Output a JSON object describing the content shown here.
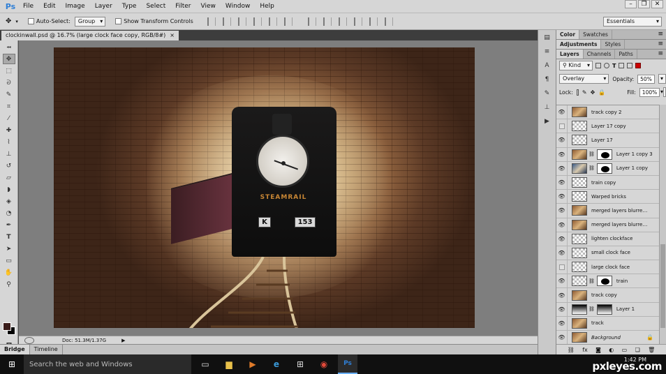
{
  "app": {
    "logo": "Ps"
  },
  "menu": [
    "File",
    "Edit",
    "Image",
    "Layer",
    "Type",
    "Select",
    "Filter",
    "View",
    "Window",
    "Help"
  ],
  "window_controls": [
    "–",
    "❐",
    "✕"
  ],
  "options": {
    "auto_select_label": "Auto-Select:",
    "auto_select_value": "Group",
    "transform_label": "Show Transform Controls",
    "workspace": "Essentials"
  },
  "document": {
    "tab_title": "clockinwall.psd @ 16.7% (large clock face copy, RGB/8#)",
    "close": "×",
    "nameplate": "STEAMRAIL",
    "plate_k": "K",
    "plate_number": "153"
  },
  "status": {
    "doc_info": "Doc: 51.3M/1.37G",
    "arrow": "▶"
  },
  "bottom_tabs": [
    "Bridge",
    "Timeline"
  ],
  "panels": {
    "tabs_row1": [
      "Color",
      "Swatches"
    ],
    "tabs_row2": [
      "Adjustments",
      "Styles"
    ],
    "tabs_row3": [
      "Layers",
      "Channels",
      "Paths"
    ]
  },
  "layers_panel": {
    "kind": "Kind",
    "blend_mode": "Overlay",
    "opacity_label": "Opacity:",
    "opacity_value": "50%",
    "lock_label": "Lock:",
    "fill_label": "Fill:",
    "fill_value": "100%",
    "layers": [
      {
        "name": "track copy 2",
        "visible": true
      },
      {
        "name": "Layer 17 copy",
        "visible": false
      },
      {
        "name": "Layer 17",
        "visible": true
      },
      {
        "name": "Layer 1 copy 3",
        "visible": true
      },
      {
        "name": "Layer 1 copy",
        "visible": true
      },
      {
        "name": "train copy",
        "visible": true
      },
      {
        "name": "Warped bricks",
        "visible": true
      },
      {
        "name": "merged layers blurred c...",
        "visible": true
      },
      {
        "name": "merged layers blurred c...",
        "visible": true
      },
      {
        "name": "lighten clockface",
        "visible": true
      },
      {
        "name": "small clock face",
        "visible": true
      },
      {
        "name": "large clock face",
        "visible": false
      },
      {
        "name": "train",
        "visible": true
      },
      {
        "name": "track copy",
        "visible": true
      },
      {
        "name": "Layer 1",
        "visible": true
      },
      {
        "name": "track",
        "visible": true
      },
      {
        "name": "Background",
        "visible": true
      }
    ]
  },
  "taskbar": {
    "search_placeholder": "Search the web and Windows",
    "time": "1:42 PM"
  },
  "watermark": "pxleyes.com"
}
